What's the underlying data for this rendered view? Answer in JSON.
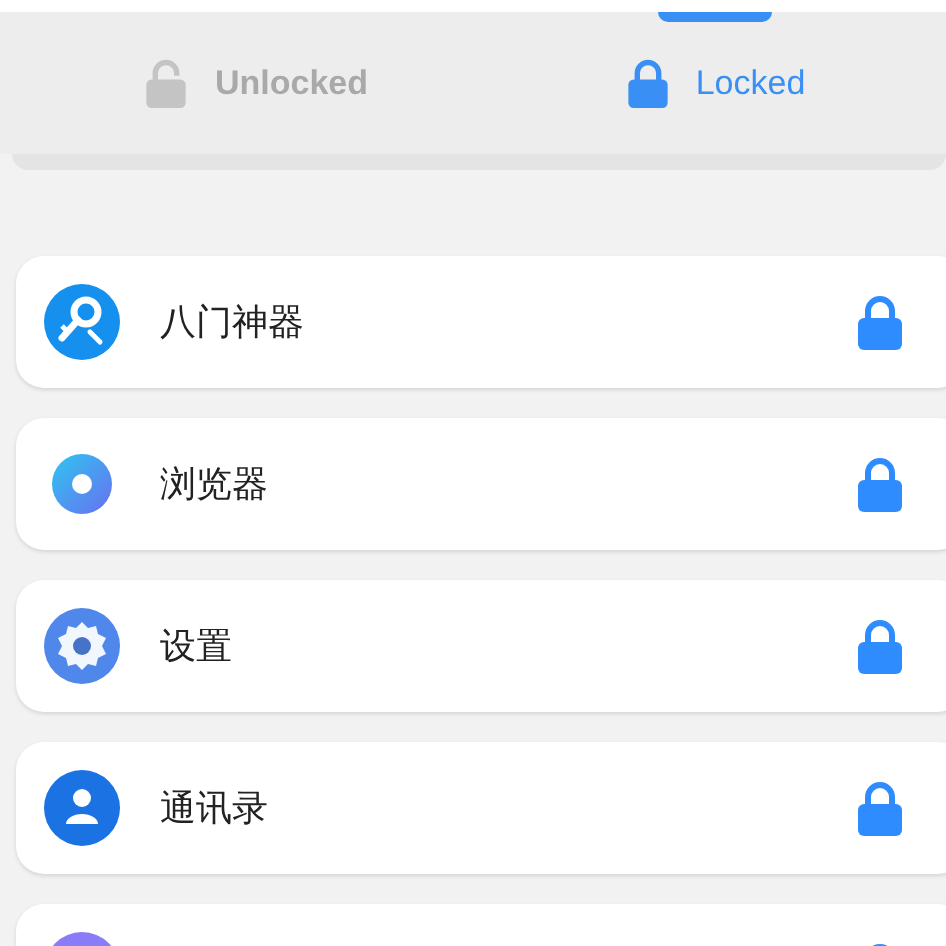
{
  "tabs": [
    {
      "label": "Unlocked",
      "kind": "unlocked",
      "selected": false
    },
    {
      "label": "Locked",
      "kind": "locked",
      "selected": true
    }
  ],
  "apps": [
    {
      "name": "八门神器",
      "kind": "key",
      "locked": true
    },
    {
      "name": "浏览器",
      "kind": "ring",
      "locked": true
    },
    {
      "name": "设置",
      "kind": "gear",
      "locked": true
    },
    {
      "name": "通讯录",
      "kind": "person",
      "locked": true
    },
    {
      "kind": "plain",
      "locked": true
    }
  ]
}
